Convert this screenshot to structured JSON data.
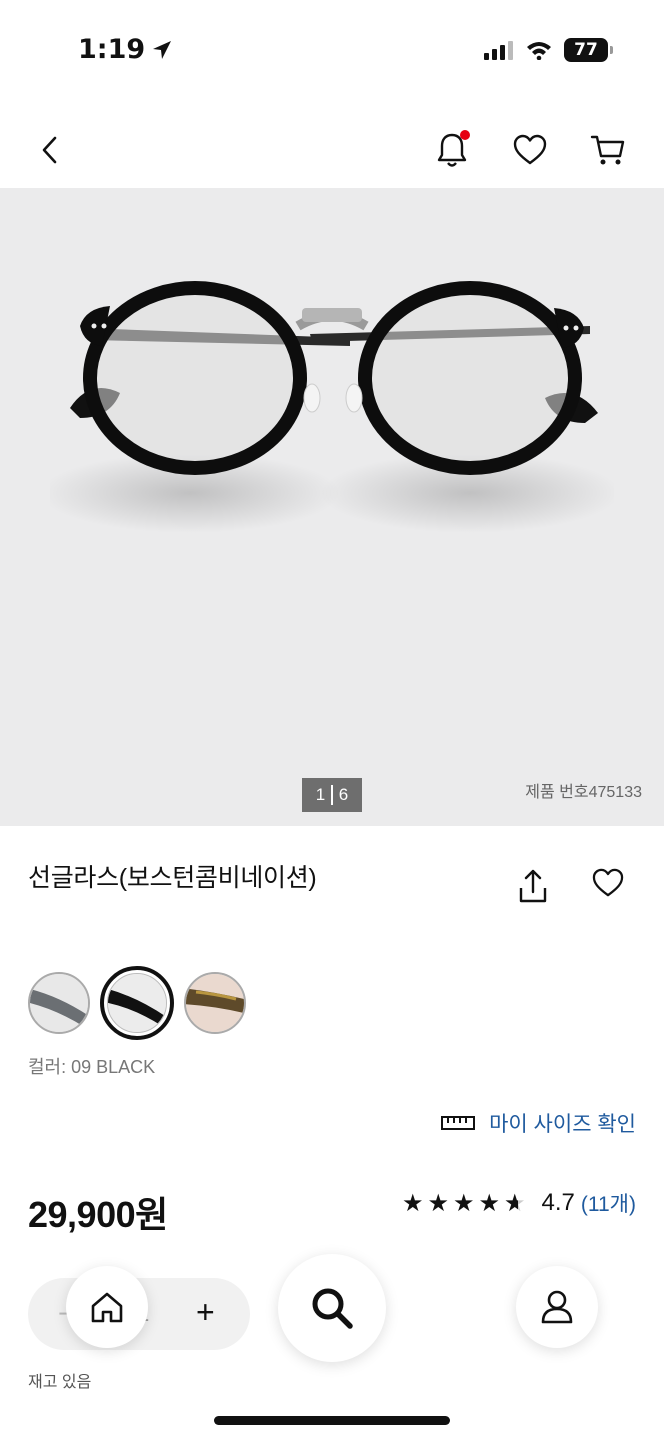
{
  "status_bar": {
    "time": "1:19",
    "battery": "77"
  },
  "nav": {
    "back": "back",
    "notification_badge": true
  },
  "hero": {
    "pager_current": "1",
    "pager_total": "6",
    "product_number": "제품 번호475133"
  },
  "product": {
    "title": "선글라스(보스턴콤비네이션)",
    "color_label": "컬러: 09 BLACK",
    "swatches": [
      {
        "name": "gray",
        "lens": "#e8e8e8",
        "frame": "#6b6f73",
        "selected": false
      },
      {
        "name": "black",
        "lens": "#ececec",
        "frame": "#111111",
        "selected": true
      },
      {
        "name": "brown",
        "lens": "#ead9cf",
        "frame": "#5e4a2a",
        "selected": false
      }
    ],
    "size_check": "마이 사이즈 확인",
    "price": "29,900원",
    "rating_value": "4.7",
    "review_count": "(11개)",
    "stars": "★★★★",
    "rating_fraction": 0.94
  },
  "quantity": {
    "minus": "−",
    "value": "1",
    "plus": "+"
  },
  "stock": "재고 있음",
  "colors": {
    "accent_link": "#1f5a9e",
    "notification": "#e60012",
    "hero_bg": "#ebebec"
  }
}
